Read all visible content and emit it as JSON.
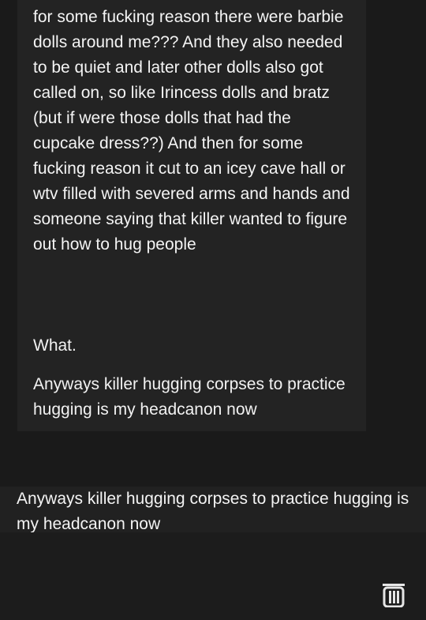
{
  "quote": {
    "body": "for some fucking reason there were barbie dolls around me??? And they also needed to be quiet and later other dolls also got called on, so like Irincess dolls and bratz (but if were those dolls that had the cupcake dress??) And then for some fucking reason it cut to an icey cave hall or wtv filled with severed arms and hands and someone saying that killer wanted to figure out how to hug people",
    "what": "What.",
    "closing": "Anyways killer hugging corpses to practice hugging is my headcanon now"
  },
  "reply": {
    "text": "Anyways killer hugging corpses to practice hugging is my headcanon now"
  },
  "toolbar": {
    "delete_icon": "trash-icon"
  }
}
